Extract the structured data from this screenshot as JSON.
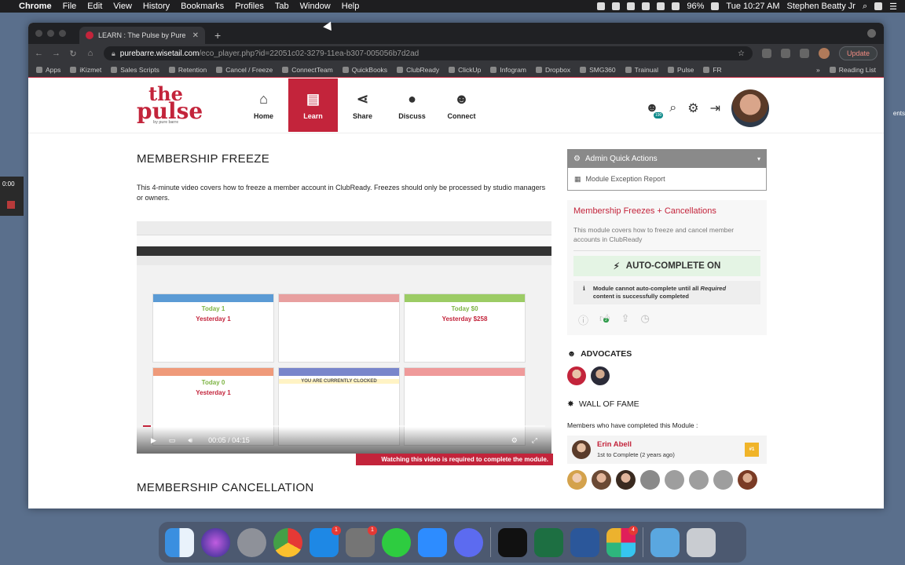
{
  "menubar": {
    "app": "Chrome",
    "menus": [
      "File",
      "Edit",
      "View",
      "History",
      "Bookmarks",
      "Profiles",
      "Tab",
      "Window",
      "Help"
    ],
    "battery": "96%",
    "clock": "Tue 10:27 AM",
    "user": "Stephen Beatty Jr"
  },
  "desktop": {
    "timer": "0:00",
    "right_text": "ents"
  },
  "browser": {
    "tab_title": "LEARN : The Pulse by Pure Barre",
    "url_host": "purebarre.wisetail.com",
    "url_path": "/eco_player.php?id=22051c02-3279-11ea-b307-005056b7d2ad",
    "update_label": "Update",
    "bookmarks": [
      "Apps",
      "iKizmet",
      "Sales Scripts",
      "Retention",
      "Cancel / Freeze",
      "ConnectTeam",
      "QuickBooks",
      "ClubReady",
      "ClickUp",
      "Infogram",
      "Dropbox",
      "SMG360",
      "Trainual",
      "Pulse",
      "FR"
    ],
    "reading_list": "Reading List",
    "more": "»"
  },
  "site": {
    "logo_line1": "the",
    "logo_line2": "pulse",
    "logo_tag": "by pure barre",
    "nav": [
      {
        "label": "Home",
        "icon": "home-icon",
        "glyph": "⌂"
      },
      {
        "label": "Learn",
        "icon": "book-icon",
        "glyph": "▤"
      },
      {
        "label": "Share",
        "icon": "share-icon",
        "glyph": "⋖"
      },
      {
        "label": "Discuss",
        "icon": "chat-icon",
        "glyph": "●"
      },
      {
        "label": "Connect",
        "icon": "users-icon",
        "glyph": "☻"
      }
    ],
    "user_count": "190"
  },
  "main": {
    "title": "MEMBERSHIP FREEZE",
    "description": "This 4-minute video covers how to freeze a member account in ClubReady. Freezes should only be processed by studio managers or owners.",
    "video": {
      "current": "00:05",
      "separator": "/",
      "duration": "04:15",
      "progress": 0.02,
      "required_note": "Watching this video is required to complete the module.",
      "panels": [
        {
          "big": "Today 1",
          "big2": "Yesterday 1"
        },
        {
          "big": "",
          "big2": ""
        },
        {
          "big": "Today $0",
          "big2": "Yesterday $258"
        },
        {
          "big": "Today 0",
          "big2": "Yesterday 1"
        },
        {
          "big": "YOU ARE CURRENTLY CLOCKED",
          "big2": ""
        },
        {
          "big": "",
          "big2": ""
        }
      ]
    },
    "next_title": "MEMBERSHIP CANCELLATION"
  },
  "sidebar": {
    "admin_quick_actions": "Admin Quick Actions",
    "module_exception_report": "Module Exception Report",
    "module_title": "Membership Freezes + Cancellations",
    "module_desc": "This module covers how to freeze and cancel member accounts in ClubReady",
    "auto_complete": "AUTO-COMPLETE ON",
    "notice_part1": "Module cannot auto-complete until all",
    "notice_required": "Required",
    "notice_part2": "content is successfully completed",
    "likes": "2",
    "advocates_label": "ADVOCATES",
    "wall_of_fame_label": "WALL OF FAME",
    "members_completed_label": "Members who have completed this Module :",
    "top_completer": {
      "name": "Erin Abell",
      "rank": "1st to Complete",
      "when": "(2 years ago)",
      "badge": "#1"
    }
  },
  "dock": {
    "badges": {
      "app_store": "1",
      "settings": "1",
      "slack": "4"
    }
  },
  "colors": {
    "brand_red": "#c3243b",
    "auto_complete_bg": "#e4f4e4",
    "admin_bar": "#8a8a8a"
  }
}
